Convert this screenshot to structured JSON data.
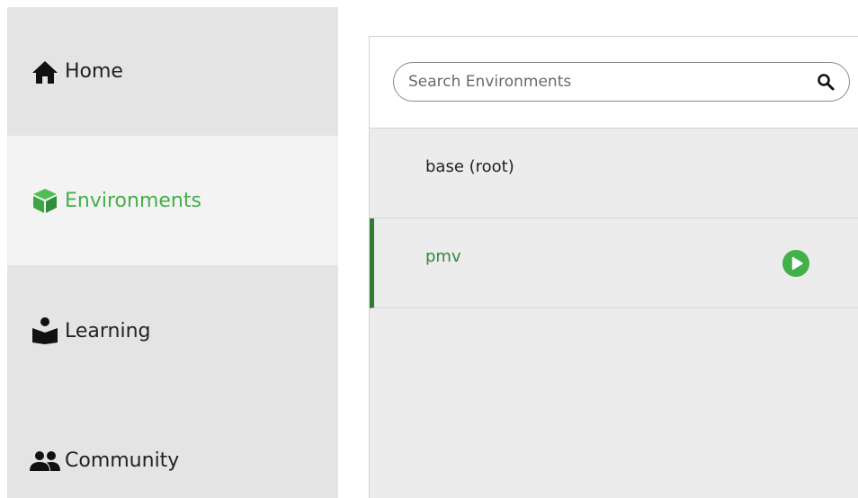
{
  "sidebar": {
    "items": [
      {
        "label": "Home",
        "icon": "home-icon"
      },
      {
        "label": "Environments",
        "icon": "cube-icon",
        "active": true
      },
      {
        "label": "Learning",
        "icon": "reader-icon"
      },
      {
        "label": "Community",
        "icon": "people-icon"
      }
    ]
  },
  "environments": {
    "search": {
      "placeholder": "Search Environments",
      "value": ""
    },
    "list": [
      {
        "name": "base (root)",
        "selected": false
      },
      {
        "name": "pmv",
        "selected": true
      }
    ]
  },
  "colors": {
    "accent": "#43b049",
    "selected_text": "#2e8b3a",
    "selected_bar": "#2e7d32",
    "sidebar_bg": "#e4e4e4",
    "panel_bg": "#ececec"
  }
}
